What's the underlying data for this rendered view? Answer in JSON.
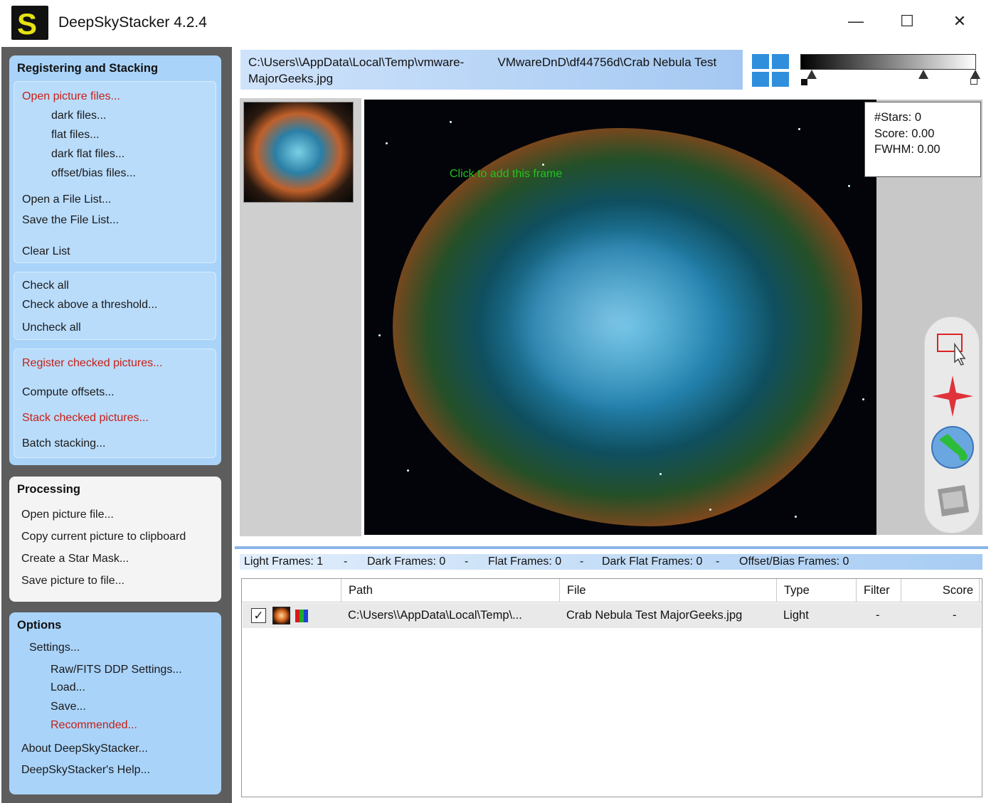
{
  "window": {
    "title": "DeepSkyStacker 4.2.4",
    "logo_letter": "S",
    "minimize": "—",
    "maximize": "☐",
    "close": "✕"
  },
  "registering": {
    "title": "Registering and Stacking",
    "open_picture_files": "Open picture files...",
    "dark_files": "dark files...",
    "flat_files": "flat files...",
    "dark_flat_files": "dark flat files...",
    "offset_bias_files": "offset/bias files...",
    "open_file_list": "Open a File List...",
    "save_file_list": "Save the File List...",
    "clear_list": "Clear List",
    "check_all": "Check all",
    "check_above_threshold": "Check above a threshold...",
    "uncheck_all": "Uncheck all",
    "register_checked": "Register checked pictures...",
    "compute_offsets": "Compute offsets...",
    "stack_checked": "Stack checked pictures...",
    "batch_stacking": "Batch stacking..."
  },
  "processing": {
    "title": "Processing",
    "open_picture_file": "Open picture file...",
    "copy_to_clipboard": "Copy current picture to clipboard",
    "create_star_mask": "Create a Star Mask...",
    "save_picture": "Save picture to file..."
  },
  "options": {
    "title": "Options",
    "settings": "Settings...",
    "raw_fits": "Raw/FITS DDP Settings...",
    "load": "Load...",
    "save": "Save...",
    "recommended": "Recommended...",
    "about": "About DeepSkyStacker...",
    "help": "DeepSkyStacker's Help..."
  },
  "viewer": {
    "path_line1": "C:\\Users\\\\AppData\\Local\\Temp\\vmware-          VMwareDnD\\df44756d\\Crab Nebula Test",
    "path_line2": "MajorGeeks.jpg",
    "overlay": "Click to add this frame",
    "stars": "#Stars: 0",
    "score": "Score: 0.00",
    "fwhm": "FWHM: 0.00"
  },
  "counts": {
    "light": "Light Frames: 1",
    "dark": "Dark Frames: 0",
    "flat": "Flat Frames: 0",
    "dark_flat": "Dark Flat Frames: 0",
    "offset_bias": "Offset/Bias Frames: 0",
    "separator": "-"
  },
  "table": {
    "columns": {
      "path": "Path",
      "file": "File",
      "type": "Type",
      "filter": "Filter",
      "score": "Score"
    },
    "rows": [
      {
        "checked": "✓",
        "path": "C:\\Users\\\\AppData\\Local\\Temp\\...",
        "file": "Crab Nebula Test MajorGeeks.jpg",
        "type": "Light",
        "filter": "-",
        "score": "-"
      }
    ]
  },
  "icons": {
    "app_logo": "deepskystacker-logo-icon",
    "layout_grid": "grid-layout-icon",
    "select_tool": "rectangle-select-icon",
    "star_tool": "star-edit-icon",
    "comet_tool": "comet-icon",
    "save_tool": "save-disk-icon",
    "thumbnail": "picture-thumbnail-icon",
    "rgb": "rgb-channels-icon"
  }
}
